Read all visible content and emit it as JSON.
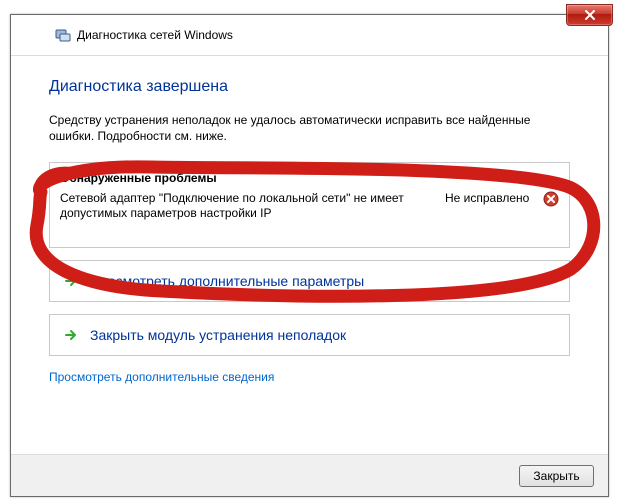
{
  "header": {
    "title": "Диагностика сетей Windows"
  },
  "content": {
    "main_heading": "Диагностика завершена",
    "intro": "Средству устранения неполадок не удалось автоматически исправить все найденные ошибки. Подробности см. ниже.",
    "problems": {
      "heading": "Обнаруженные проблемы",
      "item": {
        "description": "Сетевой адаптер \"Подключение по локальной сети\" не имеет допустимых параметров настройки IP",
        "status": "Не исправлено"
      }
    },
    "options": {
      "view_more": "Просмотреть дополнительные параметры",
      "close_troubleshooter": "Закрыть модуль устранения неполадок"
    },
    "extra_link": "Просмотреть дополнительные сведения"
  },
  "footer": {
    "close": "Закрыть"
  }
}
